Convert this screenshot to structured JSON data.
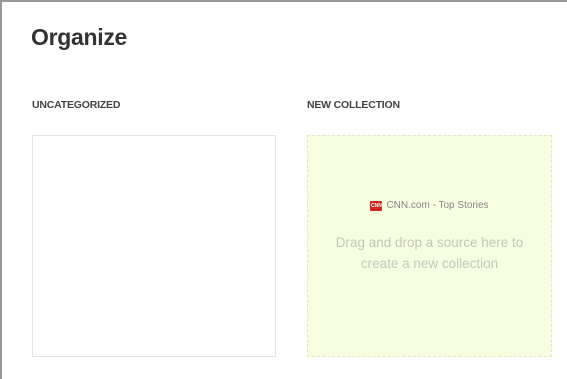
{
  "page": {
    "title": "Organize"
  },
  "sections": {
    "uncategorized": {
      "label": "UNCATEGORIZED"
    },
    "new_collection": {
      "label": "NEW COLLECTION",
      "source": {
        "icon": "cnn-logo-icon",
        "icon_text": "CNN",
        "name": "CNN.com - Top Stories"
      },
      "hint_line1": "Drag and drop a source here to",
      "hint_line2": "create a new collection"
    }
  },
  "colors": {
    "drop_zone_bg": "#f6fde0",
    "cnn_red": "#cc2a1f"
  }
}
